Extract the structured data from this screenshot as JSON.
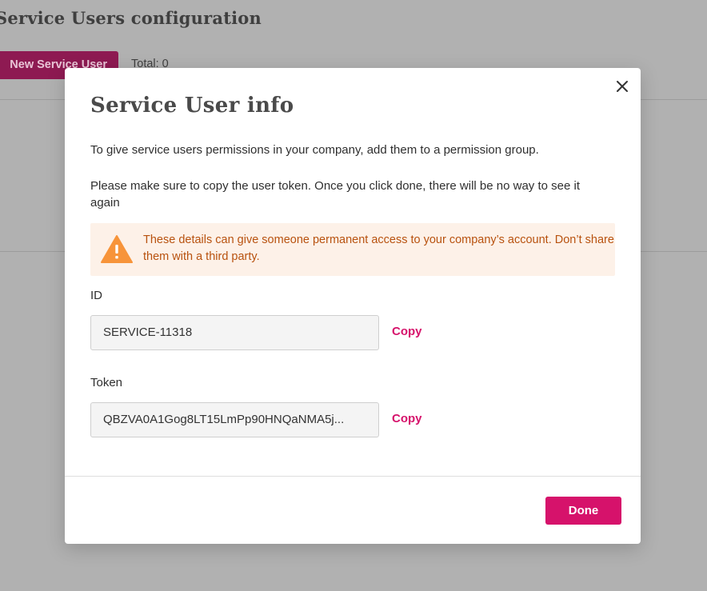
{
  "background": {
    "page_title": "Service Users configuration",
    "new_button_label": "New Service User",
    "total_label": "Total: 0"
  },
  "modal": {
    "title": "Service User info",
    "intro": "To give service users permissions in your company, add them to a permission group.",
    "instruction": "Please make sure to copy the user token. Once you click done, there will be no way to see it again",
    "warning": {
      "icon": "warning-triangle-icon",
      "text": "These details can give someone permanent access to your company’s account. Don’t share them with a third party."
    },
    "id_field": {
      "label": "ID",
      "value": "SERVICE-11318",
      "copy_label": "Copy"
    },
    "token_field": {
      "label": "Token",
      "value": "QBZVA0A1Gog8LT15LmPp90HNQaNMA5j...",
      "copy_label": "Copy"
    },
    "done_label": "Done",
    "close_icon": "close-icon"
  },
  "colors": {
    "accent": "#d6126b",
    "warning_text": "#b8520f",
    "warning_bg": "#fdf1e8",
    "warning_icon": "#f7943a"
  }
}
